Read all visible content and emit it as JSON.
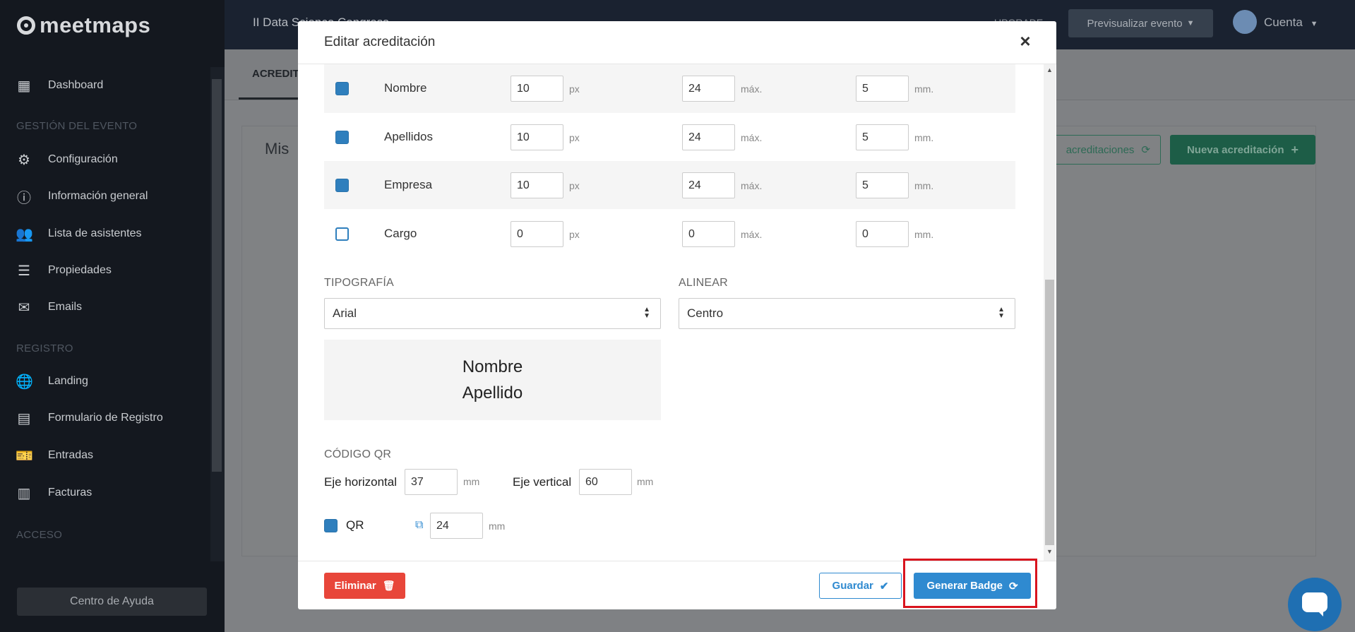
{
  "app": {
    "logo_text": "meetmaps"
  },
  "sidebar": {
    "items_top": [
      {
        "label": "Dashboard",
        "icon": "dashboard-icon"
      }
    ],
    "section_event": "GESTIÓN DEL EVENTO",
    "items_event": [
      {
        "label": "Configuración",
        "icon": "gear-icon"
      },
      {
        "label": "Información general",
        "icon": "info-icon"
      },
      {
        "label": "Lista de asistentes",
        "icon": "users-icon"
      },
      {
        "label": "Propiedades",
        "icon": "list-icon"
      },
      {
        "label": "Emails",
        "icon": "envelope-icon"
      }
    ],
    "section_registro": "REGISTRO",
    "items_registro": [
      {
        "label": "Landing",
        "icon": "globe-icon"
      },
      {
        "label": "Formulario de Registro",
        "icon": "form-icon"
      },
      {
        "label": "Entradas",
        "icon": "ticket-icon"
      },
      {
        "label": "Facturas",
        "icon": "invoice-icon"
      }
    ],
    "section_acceso": "ACCESO",
    "help_button": "Centro de Ayuda"
  },
  "topbar": {
    "event_title": "II Data Science Congress",
    "upgrade": "UPGRADE",
    "preview_button": "Previsualizar evento",
    "account": "Cuenta"
  },
  "page": {
    "tab_active": "ACREDITACIONES",
    "card_title": "Mis",
    "btn_acreditaciones": "acreditaciones",
    "btn_nueva": "Nueva acreditación"
  },
  "modal": {
    "title": "Editar acreditación",
    "close": "×",
    "fields": [
      {
        "checked": true,
        "label": "Nombre",
        "size": "10",
        "size_unit": "px",
        "max": "24",
        "max_unit": "máx.",
        "margin": "5",
        "margin_unit": "mm."
      },
      {
        "checked": true,
        "label": "Apellidos",
        "size": "10",
        "size_unit": "px",
        "max": "24",
        "max_unit": "máx.",
        "margin": "5",
        "margin_unit": "mm."
      },
      {
        "checked": true,
        "label": "Empresa",
        "size": "10",
        "size_unit": "px",
        "max": "24",
        "max_unit": "máx.",
        "margin": "5",
        "margin_unit": "mm."
      },
      {
        "checked": false,
        "label": "Cargo",
        "size": "0",
        "size_unit": "px",
        "max": "0",
        "max_unit": "máx.",
        "margin": "0",
        "margin_unit": "mm."
      }
    ],
    "tipografia_label": "TIPOGRAFÍA",
    "tipografia_value": "Arial",
    "alinear_label": "ALINEAR",
    "alinear_value": "Centro",
    "preview_line1": "Nombre",
    "preview_line2": "Apellido",
    "qr_section": "CÓDIGO QR",
    "eje_h_label": "Eje horizontal",
    "eje_h_value": "37",
    "eje_h_unit": "mm",
    "eje_v_label": "Eje vertical",
    "eje_v_value": "60",
    "eje_v_unit": "mm",
    "qr_label": "QR",
    "qr_checked": true,
    "qr_size": "24",
    "qr_unit": "mm",
    "btn_delete": "Eliminar",
    "btn_save": "Guardar",
    "btn_generate": "Generar Badge"
  },
  "colors": {
    "primary": "#2f8ad0",
    "danger": "#e8463a",
    "highlight": "#d9141e",
    "checkbox": "#2f7fbd"
  }
}
